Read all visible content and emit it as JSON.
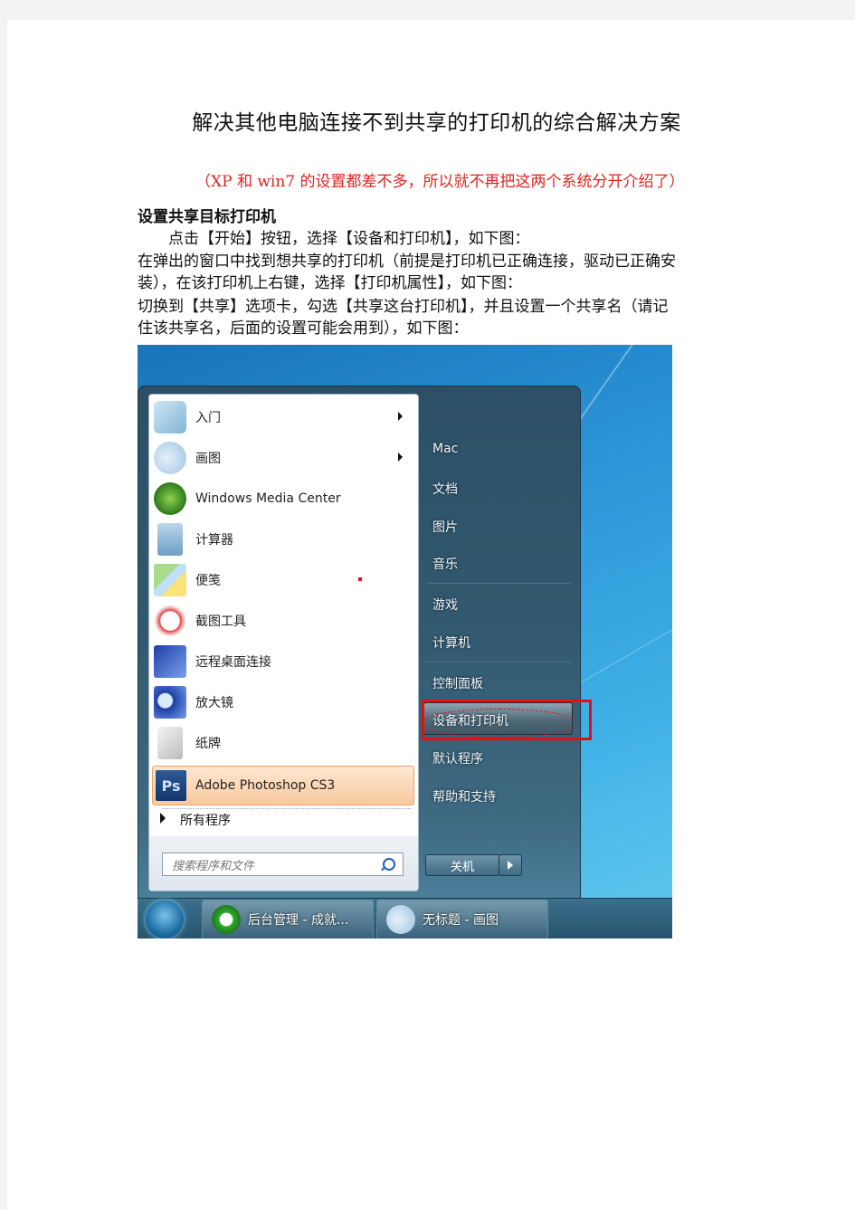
{
  "document": {
    "title": "解决其他电脑连接不到共享的打印机的综合解决方案",
    "subtitle": "（XP 和 win7 的设置都差不多，所以就不再把这两个系统分开介绍了）",
    "section_heading": "设置共享目标打印机",
    "paragraphs": [
      "　　点击【开始】按钮，选择【设备和打印机】，如下图：",
      "在弹出的窗口中找到想共享的打印机（前提是打印机已正确连接，驱动已正确安",
      "装），在该打印机上右键，选择【打印机属性】，如下图：",
      "切换到【共享】选项卡，勾选【共享这台打印机】，并且设置一个共享名（请记",
      "住该共享名，后面的设置可能会用到），如下图："
    ]
  },
  "start_menu": {
    "left_items": [
      {
        "label": "入门",
        "icon": "getting-started-icon",
        "has_submenu": true
      },
      {
        "label": "画图",
        "icon": "paint-palette-icon",
        "has_submenu": true
      },
      {
        "label": "Windows Media Center",
        "icon": "media-center-icon",
        "has_submenu": false
      },
      {
        "label": "计算器",
        "icon": "calculator-icon",
        "has_submenu": false
      },
      {
        "label": "便笺",
        "icon": "sticky-notes-icon",
        "has_submenu": false
      },
      {
        "label": "截图工具",
        "icon": "snipping-tool-icon",
        "has_submenu": false
      },
      {
        "label": "远程桌面连接",
        "icon": "remote-desktop-icon",
        "has_submenu": false
      },
      {
        "label": "放大镜",
        "icon": "magnifier-icon",
        "has_submenu": false
      },
      {
        "label": "纸牌",
        "icon": "solitaire-icon",
        "has_submenu": false
      }
    ],
    "pinned_highlight": {
      "label": "Adobe Photoshop CS3",
      "icon_text": "Ps"
    },
    "all_programs": "所有程序",
    "search_placeholder": "搜索程序和文件",
    "right_items": [
      "Mac",
      "文档",
      "图片",
      "音乐",
      "游戏",
      "计算机",
      "控制面板",
      "设备和打印机",
      "默认程序",
      "帮助和支持"
    ],
    "highlighted_right_item": "设备和打印机",
    "shutdown_label": "关机"
  },
  "taskbar": {
    "buttons": [
      {
        "label": "后台管理 - 成就...",
        "icon": "ie-icon"
      },
      {
        "label": "无标题 - 画图",
        "icon": "paint-palette-icon"
      }
    ]
  },
  "colors": {
    "annotation_red": "#e30f15",
    "subtitle_red": "#e0241e"
  }
}
